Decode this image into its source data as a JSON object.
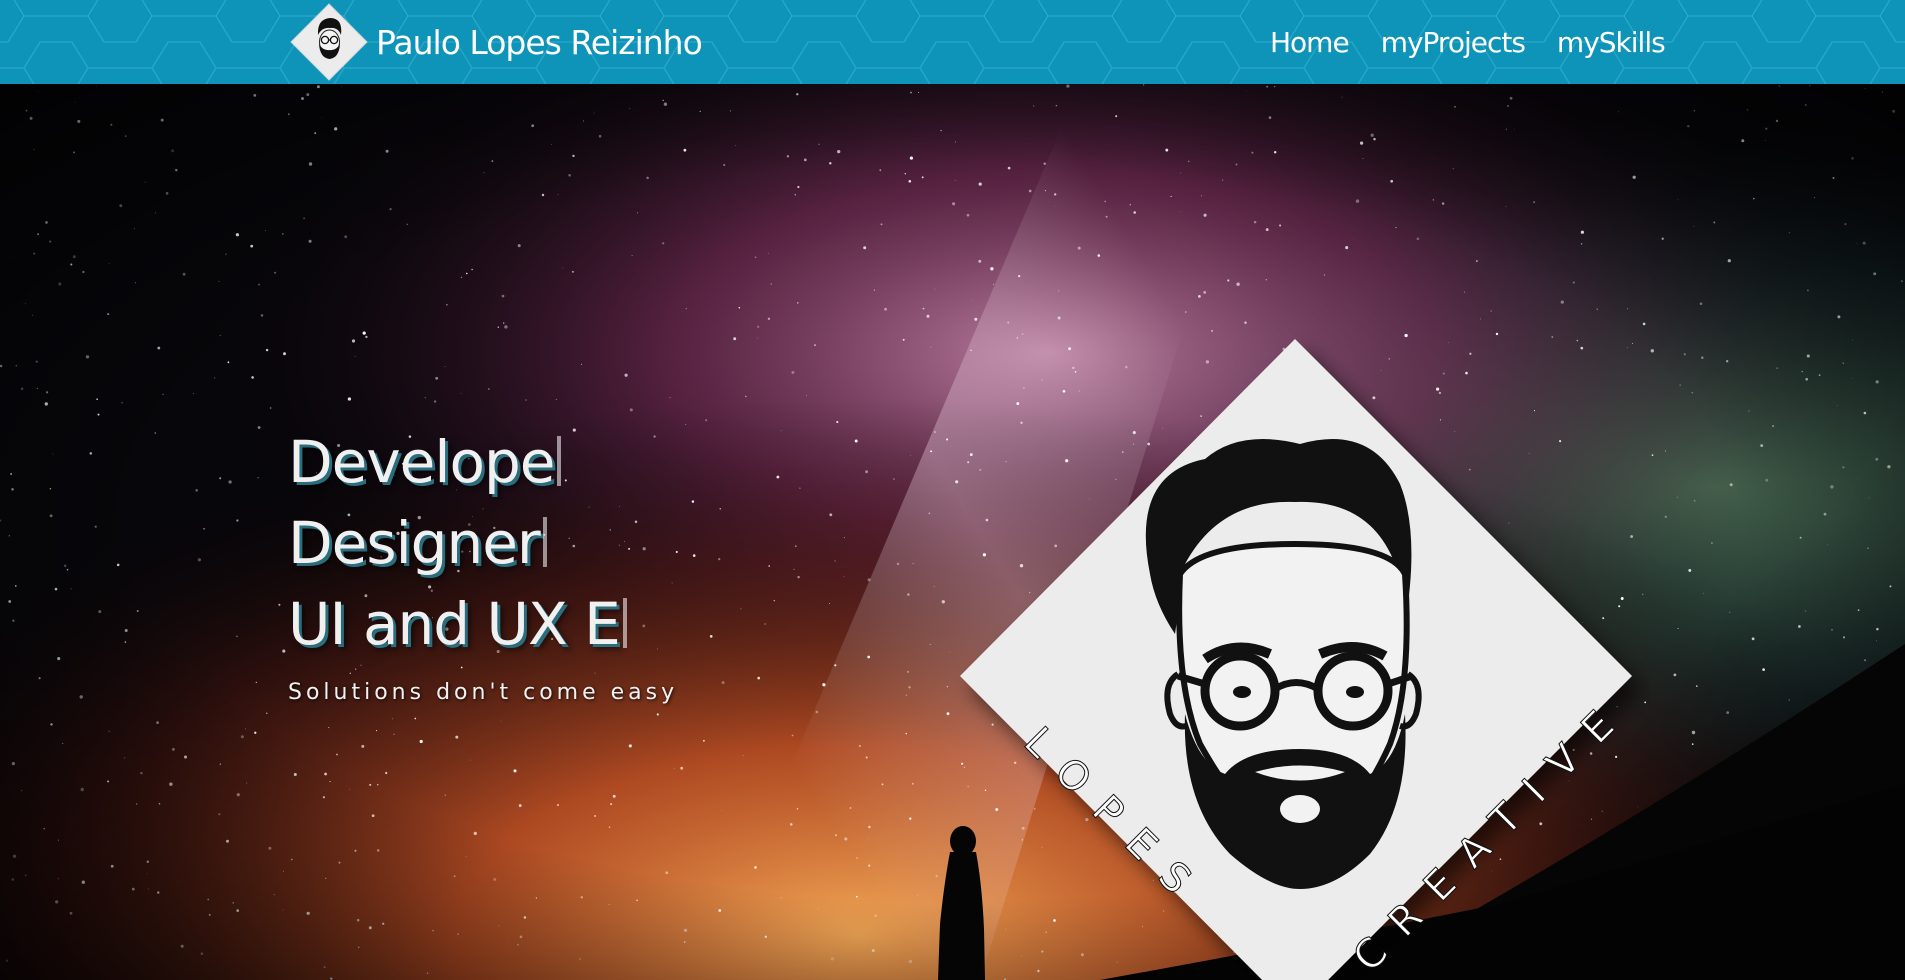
{
  "header": {
    "brand_name": "Paulo Lopes Reizinho",
    "nav": [
      {
        "label": "Home"
      },
      {
        "label": "myProjects"
      },
      {
        "label": "mySkills"
      }
    ]
  },
  "hero": {
    "lines": [
      "Develope",
      "Designer",
      "UI and UX E"
    ],
    "tagline": "Solutions don't come easy",
    "badge": {
      "left_text": "LOPES",
      "right_text": "CREATIVE"
    }
  },
  "colors": {
    "header_bg": "#0e94b8",
    "text_shadow": "#2b6d7d",
    "badge_bg": "#ececec"
  },
  "icons": [
    "avatar-logo-icon"
  ]
}
